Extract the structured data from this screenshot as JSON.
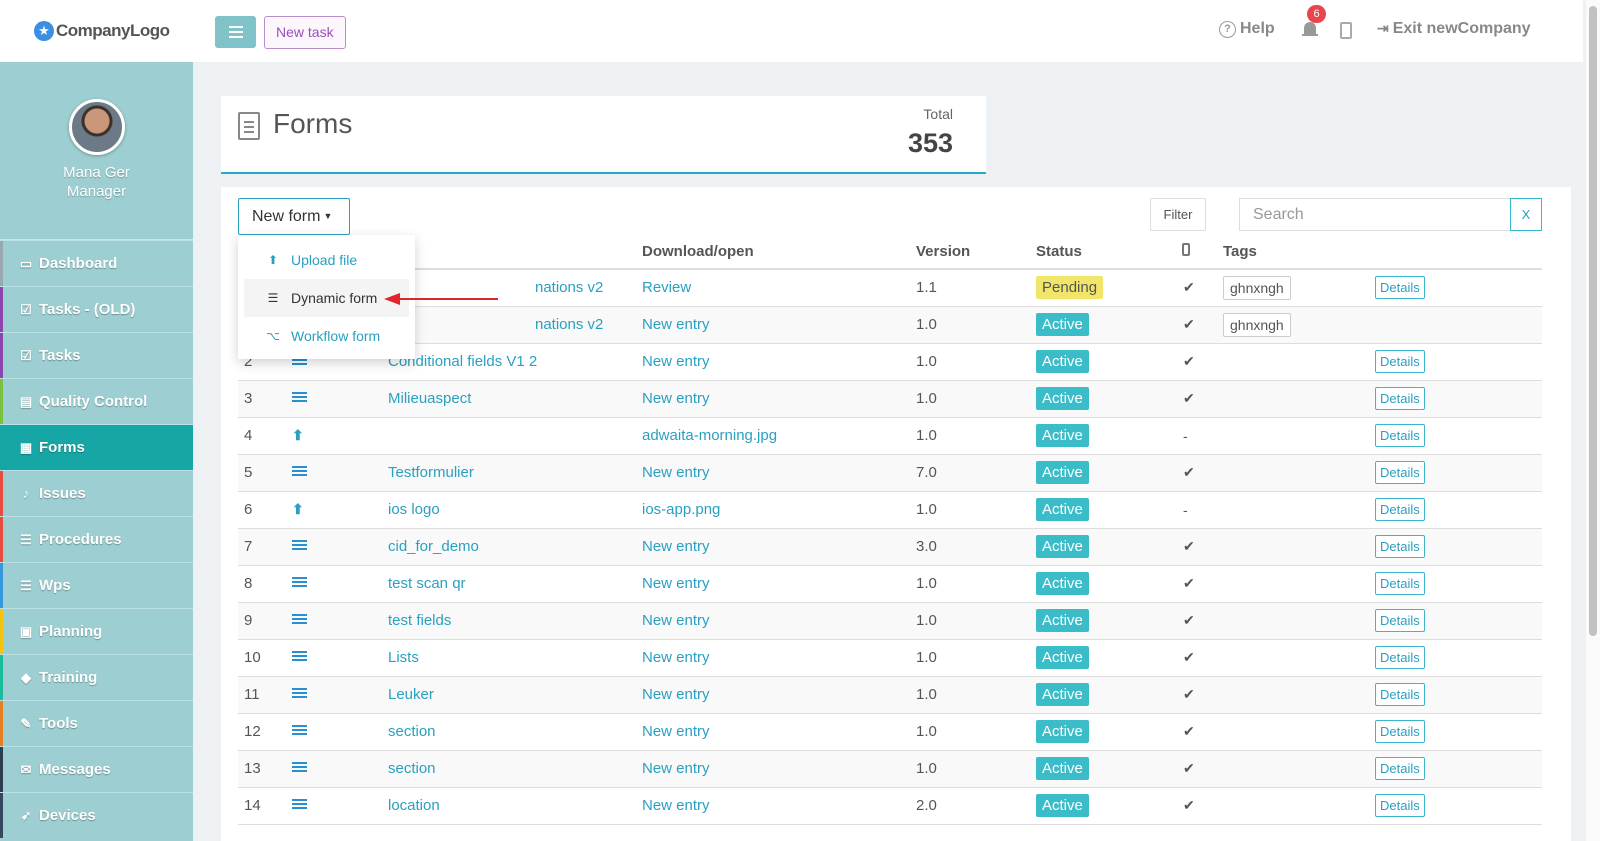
{
  "logo": {
    "text": "CompanyLogo"
  },
  "user": {
    "name": "Mana Ger",
    "role": "Manager"
  },
  "sidebar": {
    "items": [
      {
        "label": "Dashboard",
        "icon": "monitor-icon",
        "color": "#9aa7b0"
      },
      {
        "label": "Tasks - (OLD)",
        "icon": "check-square-icon",
        "color": "#8e44ad"
      },
      {
        "label": "Tasks",
        "icon": "check-square-icon",
        "color": "#8e44ad"
      },
      {
        "label": "Quality Control",
        "icon": "clipboard-icon",
        "color": "#7ac142"
      },
      {
        "label": "Forms",
        "icon": "document-icon",
        "color": "#17a6a6"
      },
      {
        "label": "Issues",
        "icon": "bell-icon",
        "color": "#e74c3c"
      },
      {
        "label": "Procedures",
        "icon": "list-icon",
        "color": "#e74c3c"
      },
      {
        "label": "Wps",
        "icon": "list-icon",
        "color": "#3498db"
      },
      {
        "label": "Planning",
        "icon": "calendar-icon",
        "color": "#f1c40f"
      },
      {
        "label": "Training",
        "icon": "graduation-cap-icon",
        "color": "#1abc9c"
      },
      {
        "label": "Tools",
        "icon": "wrench-icon",
        "color": "#e67e22"
      },
      {
        "label": "Messages",
        "icon": "envelope-icon",
        "color": "#2c3e50"
      },
      {
        "label": "Devices",
        "icon": "rocket-icon",
        "color": "#34495e"
      }
    ],
    "active_index": 4
  },
  "topbar": {
    "new_task_label": "New task",
    "help_label": "Help",
    "notification_count": "6",
    "exit_label": "Exit newCompany"
  },
  "header": {
    "title": "Forms",
    "total_label": "Total",
    "total_value": "353"
  },
  "toolbar": {
    "new_form_label": "New form",
    "filter_label": "Filter",
    "search_placeholder": "Search",
    "clear_label": "X"
  },
  "dropdown": {
    "items": [
      {
        "label": "Upload file",
        "icon": "upload-icon"
      },
      {
        "label": "Dynamic form",
        "icon": "list-icon"
      },
      {
        "label": "Workflow form",
        "icon": "workflow-icon"
      }
    ]
  },
  "table": {
    "headers": {
      "download": "Download/open",
      "version": "Version",
      "status": "Status",
      "tags": "Tags"
    },
    "rows": [
      {
        "num": "",
        "type": "list",
        "name": "nations v2",
        "download": "Review",
        "version": "1.1",
        "status": "Pending",
        "check": "✔",
        "tag": "ghnxngh",
        "details": "Details"
      },
      {
        "num": "",
        "type": "list",
        "name": "nations v2",
        "download": "New entry",
        "version": "1.0",
        "status": "Active",
        "check": "✔",
        "tag": "ghnxngh",
        "details": ""
      },
      {
        "num": "2",
        "type": "list",
        "name": "Conditional fields V1 2",
        "download": "New entry",
        "version": "1.0",
        "status": "Active",
        "check": "✔",
        "tag": "",
        "details": "Details"
      },
      {
        "num": "3",
        "type": "list",
        "name": "Milieuaspect",
        "download": "New entry",
        "version": "1.0",
        "status": "Active",
        "check": "✔",
        "tag": "",
        "details": "Details"
      },
      {
        "num": "4",
        "type": "upload",
        "name": "",
        "download": "adwaita-morning.jpg",
        "version": "1.0",
        "status": "Active",
        "check": "-",
        "tag": "",
        "details": "Details"
      },
      {
        "num": "5",
        "type": "list",
        "name": "Testformulier",
        "download": "New entry",
        "version": "7.0",
        "status": "Active",
        "check": "✔",
        "tag": "",
        "details": "Details"
      },
      {
        "num": "6",
        "type": "upload",
        "name": "ios logo",
        "download": "ios-app.png",
        "version": "1.0",
        "status": "Active",
        "check": "-",
        "tag": "",
        "details": "Details"
      },
      {
        "num": "7",
        "type": "list",
        "name": "cid_for_demo",
        "download": "New entry",
        "version": "3.0",
        "status": "Active",
        "check": "✔",
        "tag": "",
        "details": "Details"
      },
      {
        "num": "8",
        "type": "list",
        "name": "test scan qr",
        "download": "New entry",
        "version": "1.0",
        "status": "Active",
        "check": "✔",
        "tag": "",
        "details": "Details"
      },
      {
        "num": "9",
        "type": "list",
        "name": "test fields",
        "download": "New entry",
        "version": "1.0",
        "status": "Active",
        "check": "✔",
        "tag": "",
        "details": "Details"
      },
      {
        "num": "10",
        "type": "list",
        "name": "Lists",
        "download": "New entry",
        "version": "1.0",
        "status": "Active",
        "check": "✔",
        "tag": "",
        "details": "Details"
      },
      {
        "num": "11",
        "type": "list",
        "name": "Leuker",
        "download": "New entry",
        "version": "1.0",
        "status": "Active",
        "check": "✔",
        "tag": "",
        "details": "Details"
      },
      {
        "num": "12",
        "type": "list",
        "name": "section",
        "download": "New entry",
        "version": "1.0",
        "status": "Active",
        "check": "✔",
        "tag": "",
        "details": "Details"
      },
      {
        "num": "13",
        "type": "list",
        "name": "section",
        "download": "New entry",
        "version": "1.0",
        "status": "Active",
        "check": "✔",
        "tag": "",
        "details": "Details"
      },
      {
        "num": "14",
        "type": "list",
        "name": "location",
        "download": "New entry",
        "version": "2.0",
        "status": "Active",
        "check": "✔",
        "tag": "",
        "details": "Details"
      }
    ]
  },
  "colors": {
    "accent": "#2aa0c0",
    "sidebar_bg": "#9dced1",
    "active_nav": "#17a6a6",
    "pending": "#f2e66a",
    "active_status": "#3bbcc9",
    "annotation_arrow": "#e0262d"
  }
}
